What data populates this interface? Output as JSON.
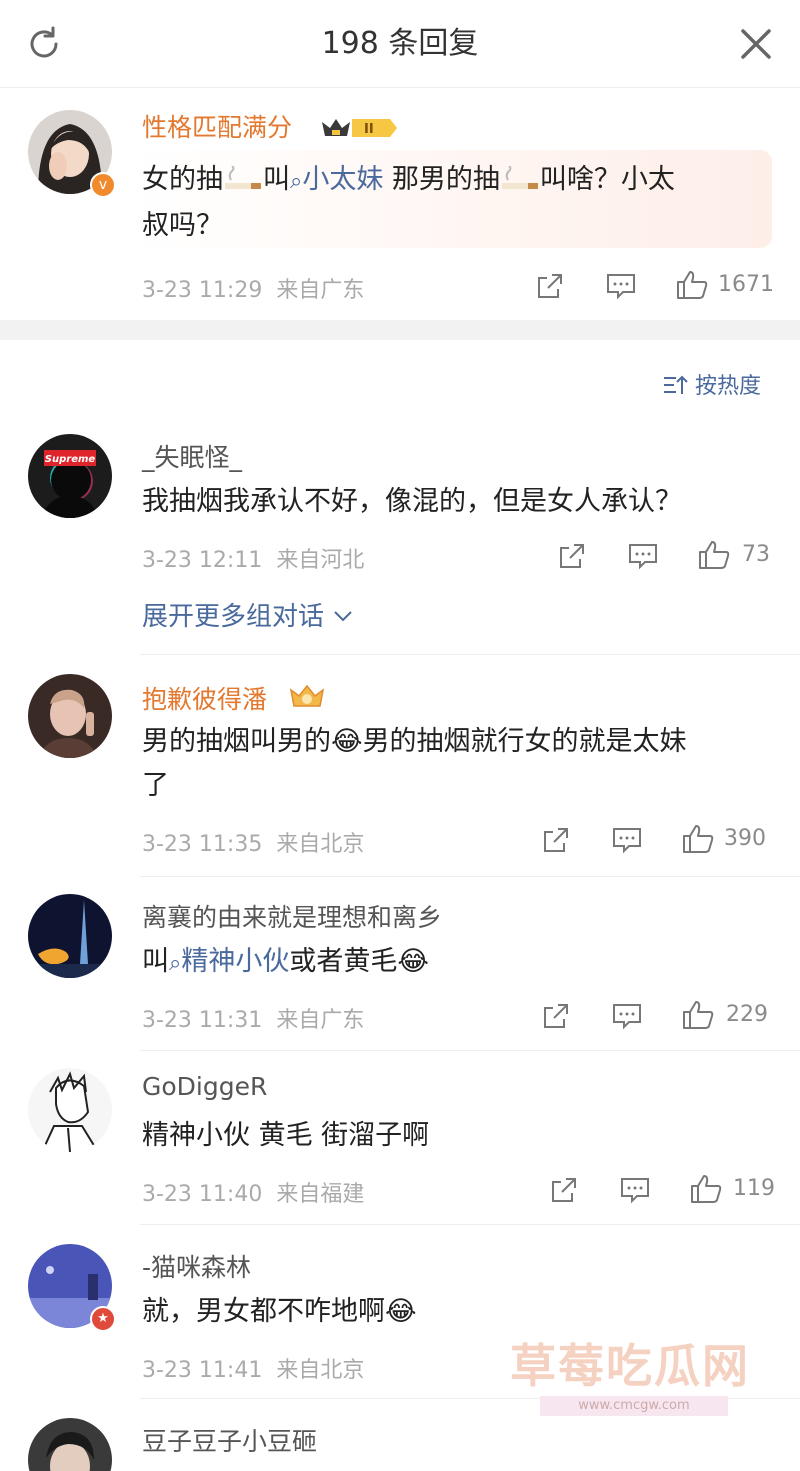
{
  "header": {
    "title": "198 条回复"
  },
  "main_comment": {
    "username": "性格匹配满分",
    "text_parts": [
      "女的抽",
      "叫",
      "小太妹",
      " 那男的抽",
      "叫啥？小太",
      "叔吗？"
    ],
    "timestamp": "3-23 11:29",
    "location": "来自广东",
    "likes": "1671"
  },
  "sort": {
    "label": "按热度"
  },
  "replies": [
    {
      "username": "_失眠怪_",
      "avatar_label": "Supreme",
      "text": "我抽烟我承认不好，像混的，但是女人承认？",
      "timestamp": "3-23 12:11",
      "location": "来自河北",
      "likes": "73",
      "expand": "展开更多组对话"
    },
    {
      "username": "抱歉彼得潘",
      "text_line1": "男的抽烟叫男的",
      "text_line1b": "男的抽烟就行女的就是太妹",
      "text_line2": "了",
      "timestamp": "3-23 11:35",
      "location": "来自北京",
      "likes": "390"
    },
    {
      "username": "离襄的由来就是理想和离乡",
      "text_prefix": "叫",
      "text_link": "精神小伙",
      "text_suffix": "或者黄毛",
      "timestamp": "3-23 11:31",
      "location": "来自广东",
      "likes": "229"
    },
    {
      "username": "GoDiggeR",
      "text": "精神小伙 黄毛 街溜子啊",
      "timestamp": "3-23 11:40",
      "location": "来自福建",
      "likes": "119"
    },
    {
      "username": "-猫咪森林",
      "text": "就，男女都不咋地啊",
      "timestamp": "3-23 11:41",
      "location": "来自北京",
      "likes": ""
    },
    {
      "username": "豆子豆子小豆砸"
    }
  ],
  "watermark": {
    "text": "草莓吃瓜网",
    "url": "www.cmcgw.com"
  },
  "colors": {
    "link": "#4a6a9d",
    "vip_name": "#e3782f",
    "meta": "#aaaaaa"
  }
}
